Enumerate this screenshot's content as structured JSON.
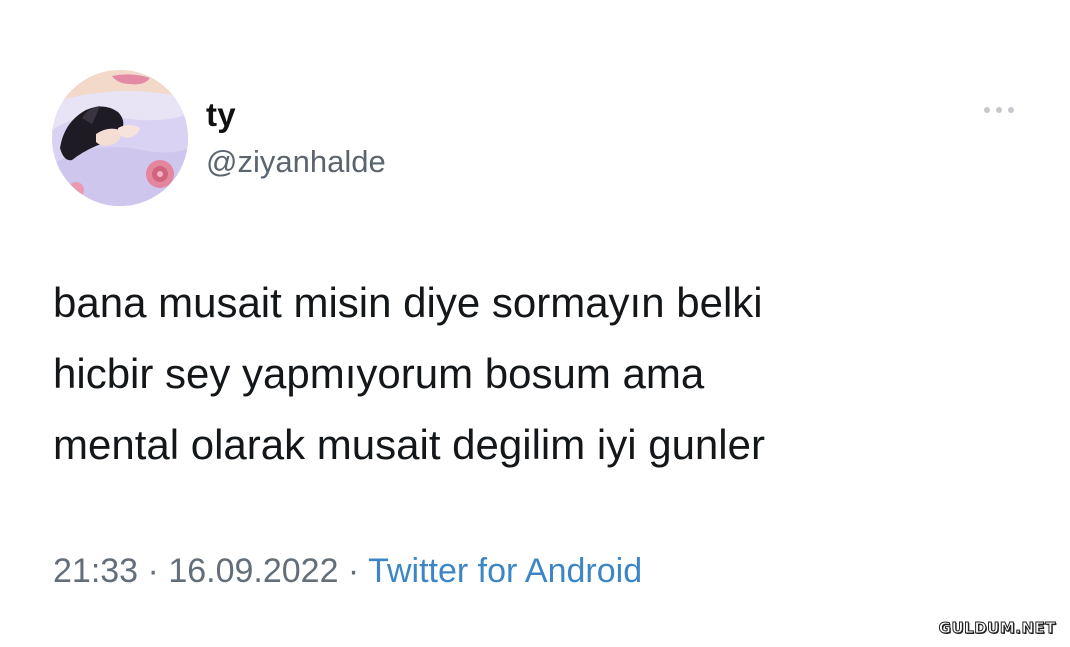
{
  "tweet": {
    "display_name": "ty",
    "handle": "@ziyanhalde",
    "text": "bana musait misin diye sormayın belki\nhicbir sey yapmıyorum bosum ama\nmental olarak musait degilim iyi gunler",
    "time": "21:33",
    "separator": " · ",
    "date": "16.09.2022",
    "source": "Twitter for Android",
    "more_icon": "more-horizontal-icon",
    "avatar_icon": "profile-avatar"
  },
  "watermark": {
    "text": "GULDUM.NET"
  },
  "colors": {
    "name": "#111111",
    "handle": "#5b6570",
    "text": "#14171a",
    "meta": "#636e78",
    "source_link": "#3d86c6"
  }
}
